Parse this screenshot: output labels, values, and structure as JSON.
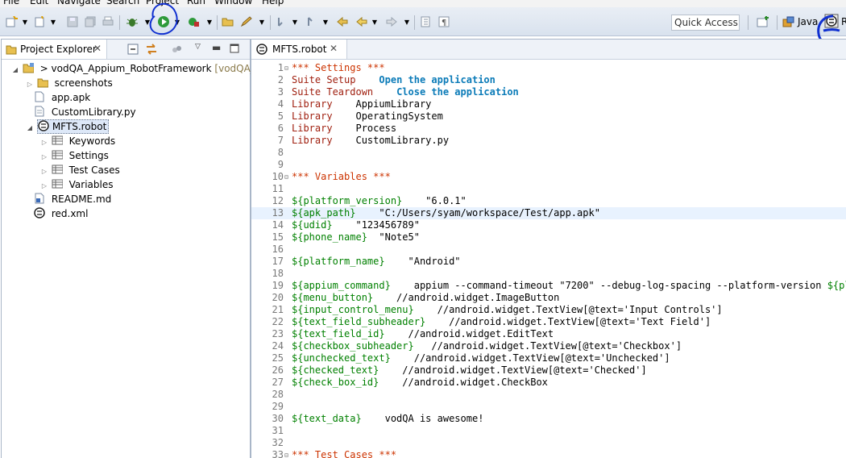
{
  "menu": [
    "File",
    "Edit",
    "Navigate",
    "Search",
    "Project",
    "Run",
    "Window",
    "Help"
  ],
  "toolbar": {
    "quick_access_placeholder": "Quick Access",
    "perspective_label": "Java"
  },
  "left_panel": {
    "tab_label": "Project Explorer",
    "project": {
      "prefix": ">",
      "name": "vodQA_Appium_RobotFramework",
      "suffix": "[vodQA_Ap"
    },
    "items": [
      {
        "label": "screenshots"
      },
      {
        "label": "app.apk"
      },
      {
        "label": "CustomLibrary.py"
      },
      {
        "label": "MFTS.robot"
      },
      {
        "label": "Keywords"
      },
      {
        "label": "Settings"
      },
      {
        "label": "Test Cases"
      },
      {
        "label": "Variables"
      },
      {
        "label": "README.md"
      },
      {
        "label": "red.xml"
      }
    ]
  },
  "editor": {
    "tab_label": "MFTS.robot",
    "lines": [
      {
        "n": "1",
        "segs": [
          [
            "sec",
            "*** Settings ***"
          ]
        ]
      },
      {
        "n": "2",
        "segs": [
          [
            "set",
            "Suite Setup"
          ],
          [
            "txt",
            "    "
          ],
          [
            "kw",
            "Open the application"
          ]
        ]
      },
      {
        "n": "3",
        "segs": [
          [
            "set",
            "Suite Teardown"
          ],
          [
            "txt",
            "    "
          ],
          [
            "kw",
            "Close the application"
          ]
        ]
      },
      {
        "n": "4",
        "segs": [
          [
            "set",
            "Library"
          ],
          [
            "txt",
            "    AppiumLibrary"
          ]
        ]
      },
      {
        "n": "5",
        "segs": [
          [
            "set",
            "Library"
          ],
          [
            "txt",
            "    OperatingSystem"
          ]
        ]
      },
      {
        "n": "6",
        "segs": [
          [
            "set",
            "Library"
          ],
          [
            "txt",
            "    Process"
          ]
        ]
      },
      {
        "n": "7",
        "segs": [
          [
            "set",
            "Library"
          ],
          [
            "txt",
            "    CustomLibrary.py"
          ]
        ]
      },
      {
        "n": "8",
        "segs": []
      },
      {
        "n": "9",
        "segs": []
      },
      {
        "n": "10",
        "segs": [
          [
            "sec",
            "*** Variables ***"
          ]
        ]
      },
      {
        "n": "11",
        "segs": []
      },
      {
        "n": "12",
        "segs": [
          [
            "var",
            "${platform_version}"
          ],
          [
            "txt",
            "    \"6.0.1\""
          ]
        ]
      },
      {
        "n": "13",
        "segs": [
          [
            "var",
            "${apk_path}"
          ],
          [
            "txt",
            "    \"C:/Users/syam/workspace/Test/app.apk\""
          ]
        ]
      },
      {
        "n": "14",
        "segs": [
          [
            "var",
            "${udid}"
          ],
          [
            "txt",
            "    \"123456789\""
          ]
        ]
      },
      {
        "n": "15",
        "segs": [
          [
            "var",
            "${phone_name}"
          ],
          [
            "txt",
            "  \"Note5\""
          ]
        ]
      },
      {
        "n": "16",
        "segs": []
      },
      {
        "n": "17",
        "segs": [
          [
            "var",
            "${platform_name}"
          ],
          [
            "txt",
            "    \"Android\""
          ]
        ]
      },
      {
        "n": "18",
        "segs": []
      },
      {
        "n": "19",
        "segs": [
          [
            "var",
            "${appium_command}"
          ],
          [
            "txt",
            "    appium --command-timeout \"7200\" --debug-log-spacing --platform-version "
          ],
          [
            "var",
            "${platf"
          ]
        ]
      },
      {
        "n": "20",
        "segs": [
          [
            "var",
            "${menu_button}"
          ],
          [
            "txt",
            "    //android.widget.ImageButton"
          ]
        ]
      },
      {
        "n": "21",
        "segs": [
          [
            "var",
            "${input_control_menu}"
          ],
          [
            "txt",
            "    //android.widget.TextView[@text='Input Controls']"
          ]
        ]
      },
      {
        "n": "22",
        "segs": [
          [
            "var",
            "${text_field_subheader}"
          ],
          [
            "txt",
            "    //android.widget.TextView[@text='Text Field']"
          ]
        ]
      },
      {
        "n": "23",
        "segs": [
          [
            "var",
            "${text_field_id}"
          ],
          [
            "txt",
            "    //android.widget.EditText"
          ]
        ]
      },
      {
        "n": "24",
        "segs": [
          [
            "var",
            "${checkbox_subheader}"
          ],
          [
            "txt",
            "   //android.widget.TextView[@text='Checkbox']"
          ]
        ]
      },
      {
        "n": "25",
        "segs": [
          [
            "var",
            "${unchecked_text}"
          ],
          [
            "txt",
            "    //android.widget.TextView[@text='Unchecked']"
          ]
        ]
      },
      {
        "n": "26",
        "segs": [
          [
            "var",
            "${checked_text}"
          ],
          [
            "txt",
            "    //android.widget.TextView[@text='Checked']"
          ]
        ]
      },
      {
        "n": "27",
        "segs": [
          [
            "var",
            "${check_box_id}"
          ],
          [
            "txt",
            "    //android.widget.CheckBox"
          ]
        ]
      },
      {
        "n": "28",
        "segs": []
      },
      {
        "n": "29",
        "segs": []
      },
      {
        "n": "30",
        "segs": [
          [
            "var",
            "${text_data}"
          ],
          [
            "txt",
            "    vodQA is awesome!"
          ]
        ]
      },
      {
        "n": "31",
        "segs": []
      },
      {
        "n": "32",
        "segs": []
      },
      {
        "n": "33",
        "segs": [
          [
            "sec",
            "*** Test Cases ***"
          ]
        ]
      }
    ]
  },
  "colors": {
    "section_header": "#cc3300",
    "setting_name": "#a02010",
    "keyword": "#0b7bb8",
    "variable": "#008000",
    "highlight_line": "#e8f2fe",
    "annotation_pen": "#1030d0"
  }
}
